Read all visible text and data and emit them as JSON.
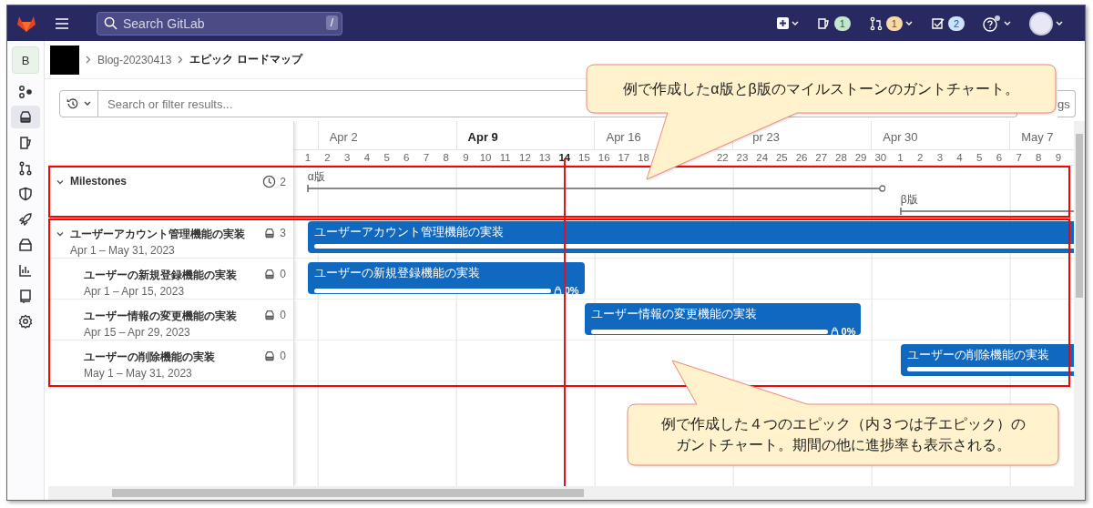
{
  "topbar": {
    "search": {
      "placeholder": "Search GitLab",
      "shortcut": "/"
    },
    "badges": [
      {
        "kind": "issues",
        "count": "1"
      },
      {
        "kind": "merge_requests",
        "count": "1"
      },
      {
        "kind": "todos",
        "count": "2"
      }
    ]
  },
  "sidebar": {
    "avatar": "B",
    "items": [
      {
        "selected": false
      },
      {
        "selected": true
      },
      {
        "selected": false
      },
      {
        "selected": false
      },
      {
        "selected": false
      },
      {
        "selected": false
      },
      {
        "selected": false
      },
      {
        "selected": false
      },
      {
        "selected": false
      },
      {
        "selected": false
      }
    ]
  },
  "breadcrumb": [
    "Blog-20230413",
    "エピック ロードマップ"
  ],
  "filter": {
    "placeholder": "Search or filter results...",
    "button": "gs"
  },
  "timeline": {
    "weeks": [
      {
        "label": "Apr 2",
        "current": false
      },
      {
        "label": "Apr 9",
        "current": true
      },
      {
        "label": "Apr 16",
        "current": false
      },
      {
        "label": "pr 23",
        "current": false
      },
      {
        "label": "Apr 30",
        "current": false
      },
      {
        "label": "May 7",
        "current": false
      }
    ],
    "days": [
      {
        "label": "1",
        "today": false
      },
      {
        "label": "2",
        "today": false
      },
      {
        "label": "3",
        "today": false
      },
      {
        "label": "4",
        "today": false
      },
      {
        "label": "5",
        "today": false
      },
      {
        "label": "6",
        "today": false
      },
      {
        "label": "7",
        "today": false
      },
      {
        "label": "8",
        "today": false
      },
      {
        "label": "9",
        "today": false
      },
      {
        "label": "10",
        "today": false
      },
      {
        "label": "11",
        "today": false
      },
      {
        "label": "12",
        "today": false
      },
      {
        "label": "13",
        "today": false
      },
      {
        "label": "14",
        "today": true
      },
      {
        "label": "15",
        "today": false
      },
      {
        "label": "16",
        "today": false
      },
      {
        "label": "17",
        "today": false
      },
      {
        "label": "18",
        "today": false
      },
      {
        "label": "22",
        "today": false
      },
      {
        "label": "23",
        "today": false
      },
      {
        "label": "24",
        "today": false
      },
      {
        "label": "25",
        "today": false
      },
      {
        "label": "26",
        "today": false
      },
      {
        "label": "27",
        "today": false
      },
      {
        "label": "28",
        "today": false
      },
      {
        "label": "29",
        "today": false
      },
      {
        "label": "30",
        "today": false
      },
      {
        "label": "1",
        "today": false
      },
      {
        "label": "2",
        "today": false
      },
      {
        "label": "3",
        "today": false
      },
      {
        "label": "4",
        "today": false
      },
      {
        "label": "5",
        "today": false
      },
      {
        "label": "6",
        "today": false
      },
      {
        "label": "7",
        "today": false
      },
      {
        "label": "8",
        "today": false
      },
      {
        "label": "9",
        "today": false
      }
    ]
  },
  "milestones": {
    "title": "Milestones",
    "count": "2",
    "expanded": true,
    "items": [
      {
        "label": "α版"
      },
      {
        "label": "β版"
      }
    ]
  },
  "epics": [
    {
      "title": "ユーザーアカウント管理機能の実装",
      "dates": "Apr 1 – May 31, 2023",
      "count": "3",
      "expanded": true,
      "bar_title": "ユーザーアカウント管理機能の実装",
      "level": 0,
      "children": [
        {
          "title": "ユーザーの新規登録機能の実装",
          "dates": "Apr 1 – Apr 15, 2023",
          "count": "0",
          "bar_title": "ユーザーの新規登録機能の実装",
          "level": 0,
          "progress": "0%"
        },
        {
          "title": "ユーザー情報の変更機能の実装",
          "dates": "Apr 15 – Apr 29, 2023",
          "count": "0",
          "bar_title": "ユーザー情報の変更機能の実装",
          "level": 0,
          "progress": "0%"
        },
        {
          "title": "ユーザーの削除機能の実装",
          "dates": "May 1 – May 31, 2023",
          "count": "0",
          "bar_title": "ユーザーの削除機能の実装",
          "level": 0
        }
      ]
    }
  ],
  "callouts": [
    {
      "lines": [
        "例で作成したα版とβ版のマイルストーンのガントチャート。"
      ]
    },
    {
      "lines": [
        "例で作成した４つのエピック（内３つは子エピック）の",
        "ガントチャート。期間の他に進捗率も表示される。"
      ]
    }
  ]
}
